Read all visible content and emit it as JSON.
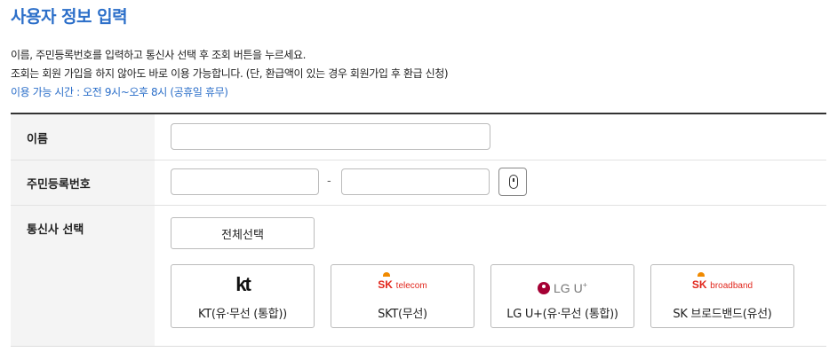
{
  "page_title": "사용자 정보 입력",
  "instructions": {
    "line1": "이름, 주민등록번호를 입력하고 통신사 선택 후 조회 버튼을 누르세요.",
    "line2": "조회는 회원 가입을 하지 않아도 바로 이용 가능합니다. (단, 환급액이 있는 경우 회원가입 후 환급 신청)",
    "hours": "이용 가능 시간 : 오전 9시~오후 8시 (공휴일 휴무)"
  },
  "form": {
    "name": {
      "label": "이름",
      "value": "",
      "placeholder": ""
    },
    "rrn": {
      "label": "주민등록번호",
      "front_value": "",
      "back_value": "",
      "separator": "-",
      "toggle_icon": "mouse-icon"
    },
    "carrier": {
      "label": "통신사 선택",
      "select_all_label": "전체선택",
      "options": [
        {
          "name": "KT(유·무선 (통합))",
          "logo_text": "kt"
        },
        {
          "name": "SKT(무선)",
          "logo_main": "SK",
          "logo_sub": "telecom"
        },
        {
          "name": "LG U+(유·무선 (통합))",
          "logo_text": "LG U",
          "logo_sup": "+"
        },
        {
          "name": "SK 브로드밴드(유선)",
          "logo_main": "SK",
          "logo_sub": "broadband"
        }
      ]
    }
  },
  "colors": {
    "accent": "#2c6fc9",
    "sk_red": "#e1261c",
    "lg_magenta": "#a50034"
  }
}
